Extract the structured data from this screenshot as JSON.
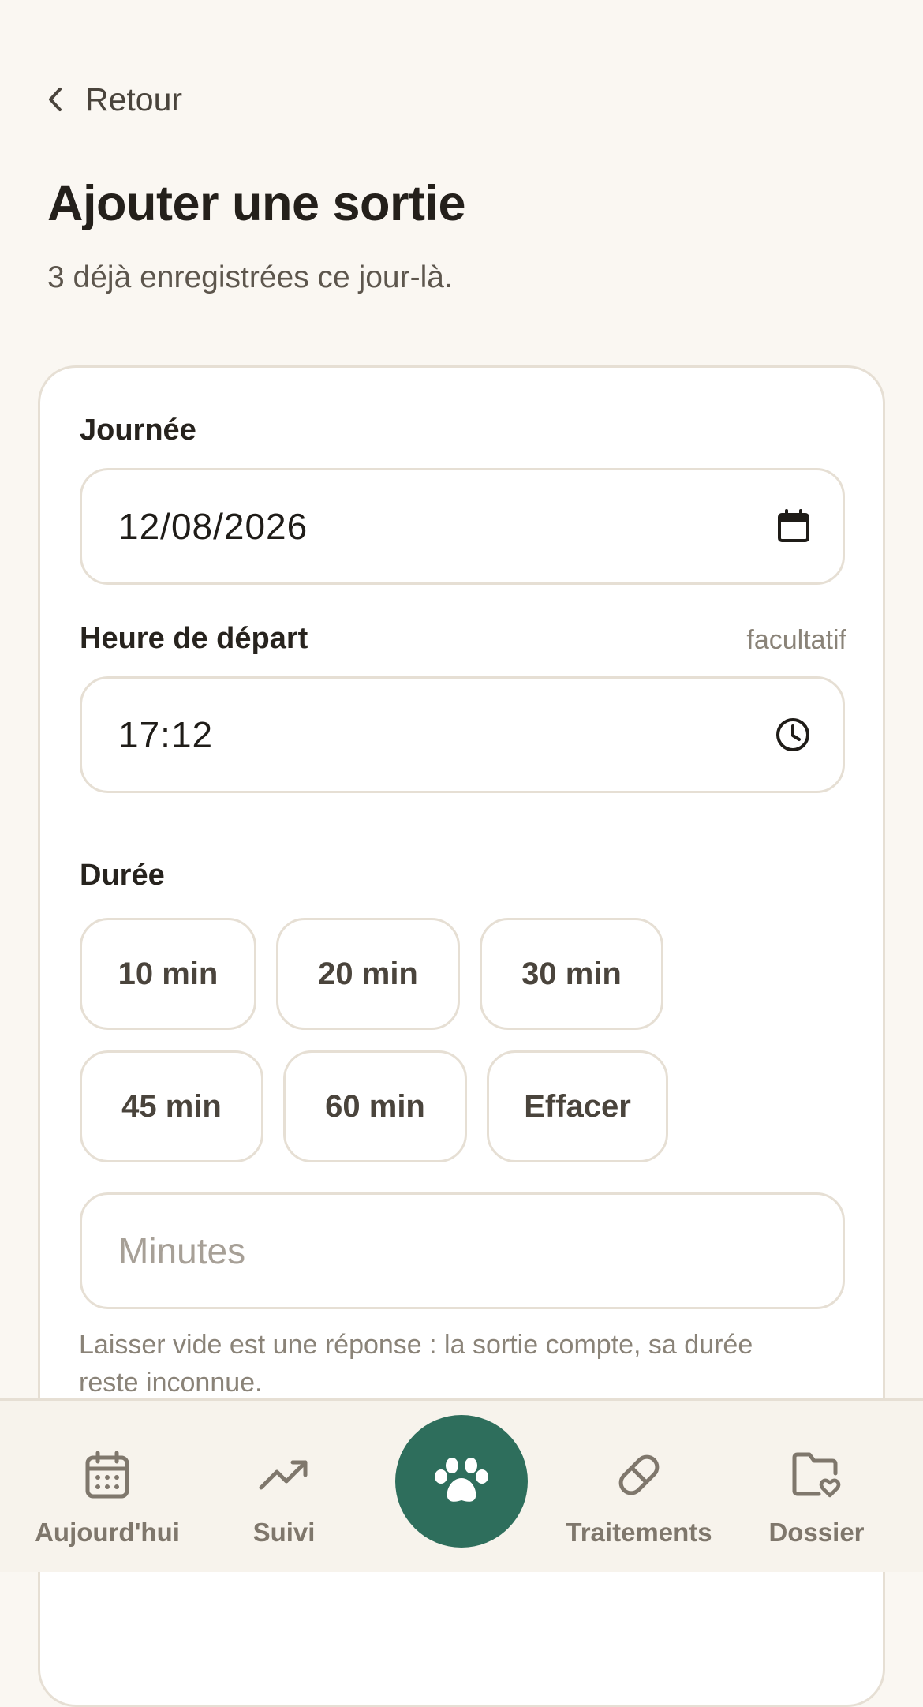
{
  "header": {
    "back_label": "Retour",
    "title": "Ajouter une sortie",
    "subtitle": "3 déjà enregistrées ce jour-là."
  },
  "form": {
    "day": {
      "label": "Journée",
      "value": "12/08/2026",
      "icon": "calendar-icon"
    },
    "departure_time": {
      "label": "Heure de départ",
      "hint": "facultatif",
      "value": "17:12",
      "icon": "clock-icon"
    },
    "duration": {
      "label": "Durée",
      "chips": [
        "10 min",
        "20 min",
        "30 min",
        "45 min",
        "60 min",
        "Effacer"
      ],
      "minutes_placeholder": "Minutes",
      "helper": "Laisser vide est une réponse : la sortie compte, sa durée reste inconnue."
    }
  },
  "bottom_nav": {
    "items": [
      {
        "label": "Aujourd'hui",
        "icon": "calendar-icon"
      },
      {
        "label": "Suivi",
        "icon": "trend-up-icon"
      },
      {
        "label": "Traitements",
        "icon": "pill-icon"
      },
      {
        "label": "Dossier",
        "icon": "folder-heart-icon"
      }
    ],
    "center_action": {
      "icon": "paw-icon"
    }
  },
  "colors": {
    "background": "#faf7f2",
    "card": "#ffffff",
    "border": "#e6dfd4",
    "accent": "#2e6e5c",
    "muted_text": "#8a8378",
    "nav_text": "#7f776c"
  }
}
